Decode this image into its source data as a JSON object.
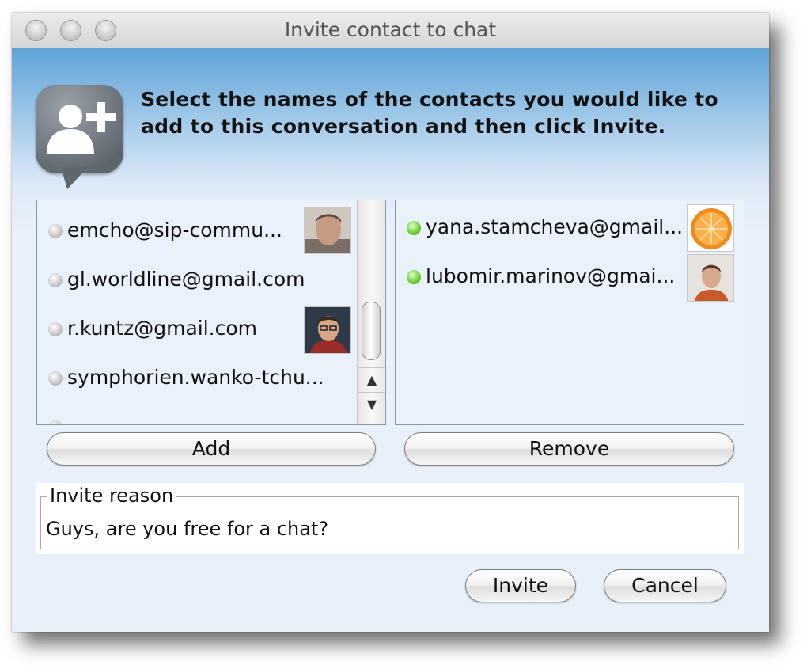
{
  "window": {
    "title": "Invite contact to chat"
  },
  "header": {
    "icon": "add-contact-bubble-icon",
    "instruction": "Select the names of the contacts you would like to add to this conversation and then click Invite."
  },
  "available_contacts": [
    {
      "name": "emcho@sip-commu...",
      "status": "offline",
      "avatar": "photo"
    },
    {
      "name": "gl.worldline@gmail.com",
      "status": "offline",
      "avatar": ""
    },
    {
      "name": "r.kuntz@gmail.com",
      "status": "offline",
      "avatar": "photo"
    },
    {
      "name": "symphorien.wanko-tchu...",
      "status": "offline",
      "avatar": ""
    }
  ],
  "selected_contacts": [
    {
      "name": "yana.stamcheva@gmail...",
      "status": "online",
      "avatar": "orange"
    },
    {
      "name": "lubomir.marinov@gmai...",
      "status": "online",
      "avatar": "photo"
    }
  ],
  "buttons": {
    "add": "Add",
    "remove": "Remove",
    "invite": "Invite",
    "cancel": "Cancel"
  },
  "reason": {
    "legend": "Invite reason",
    "value": "Guys, are you free for a chat?"
  },
  "colors": {
    "online": "#6fd13a",
    "offline": "#c9c9c9",
    "header_gradient_top": "#5fa3d8"
  }
}
